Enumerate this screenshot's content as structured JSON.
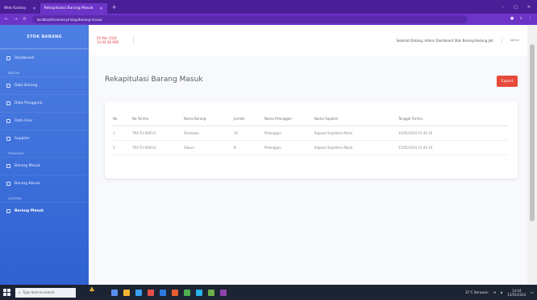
{
  "browser": {
    "tabs": [
      {
        "label": "Web Kasbay",
        "active": false
      },
      {
        "label": "Rekapitulasi Barang Masuk",
        "active": true
      }
    ],
    "new_tab": "+",
    "minimize": "–",
    "maximize": "□",
    "close": "✕",
    "url": "localhost/inventory/rekap/barang-masuk",
    "back": "←",
    "forward": "→",
    "reload": "⟳"
  },
  "sidebar": {
    "brand": "STOK BARANG",
    "dashboard": "Dashboard",
    "section_master": "MASTER",
    "items_master": [
      "Data Barang",
      "Data Pengguna",
      "Data User",
      "Supplier"
    ],
    "section_transaksi": "TRANSAKSI",
    "items_transaksi": [
      "Barang Masuk",
      "Barang Keluar"
    ],
    "section_laporan": "LAPORAN",
    "items_laporan": [
      "Barang Masuk"
    ]
  },
  "topbar": {
    "date": "05 Mei 2024",
    "time": "14:44:38 WIB",
    "welcome": "Selamat Datang, Admin Dashboard Stok Barang Kedung Jati",
    "user": "Admin"
  },
  "page": {
    "title": "Rekapitulasi Barang Masuk",
    "export_label": "Export",
    "columns": [
      "No",
      "No Terima",
      "Nama Barang",
      "Jumlah",
      "Nama Pelanggan",
      "Nama Supplier",
      "Tanggal Terima"
    ],
    "rows": [
      [
        "1",
        "TRX-TU-0001/1",
        "Shampoo",
        "10",
        "Pelanggan",
        "Kapuas Sejahtera Mulia",
        "15/05/2024 15.42.10"
      ],
      [
        "2",
        "TRX-TU-0001/2",
        "Sabun",
        "8",
        "Pelanggan",
        "Kapuas Sejahtera Mulia",
        "15/05/2024 15.43.14"
      ]
    ]
  },
  "taskbar": {
    "search_placeholder": "Type here to search",
    "weather": "31°C Berawan",
    "time": "14:44",
    "date": "15/05/2024"
  },
  "colors": {
    "sidebar_top": "#4e7fe3",
    "sidebar_bottom": "#2f62d2",
    "browser_bar": "#6c35c8",
    "export_button": "#e74a3b"
  }
}
